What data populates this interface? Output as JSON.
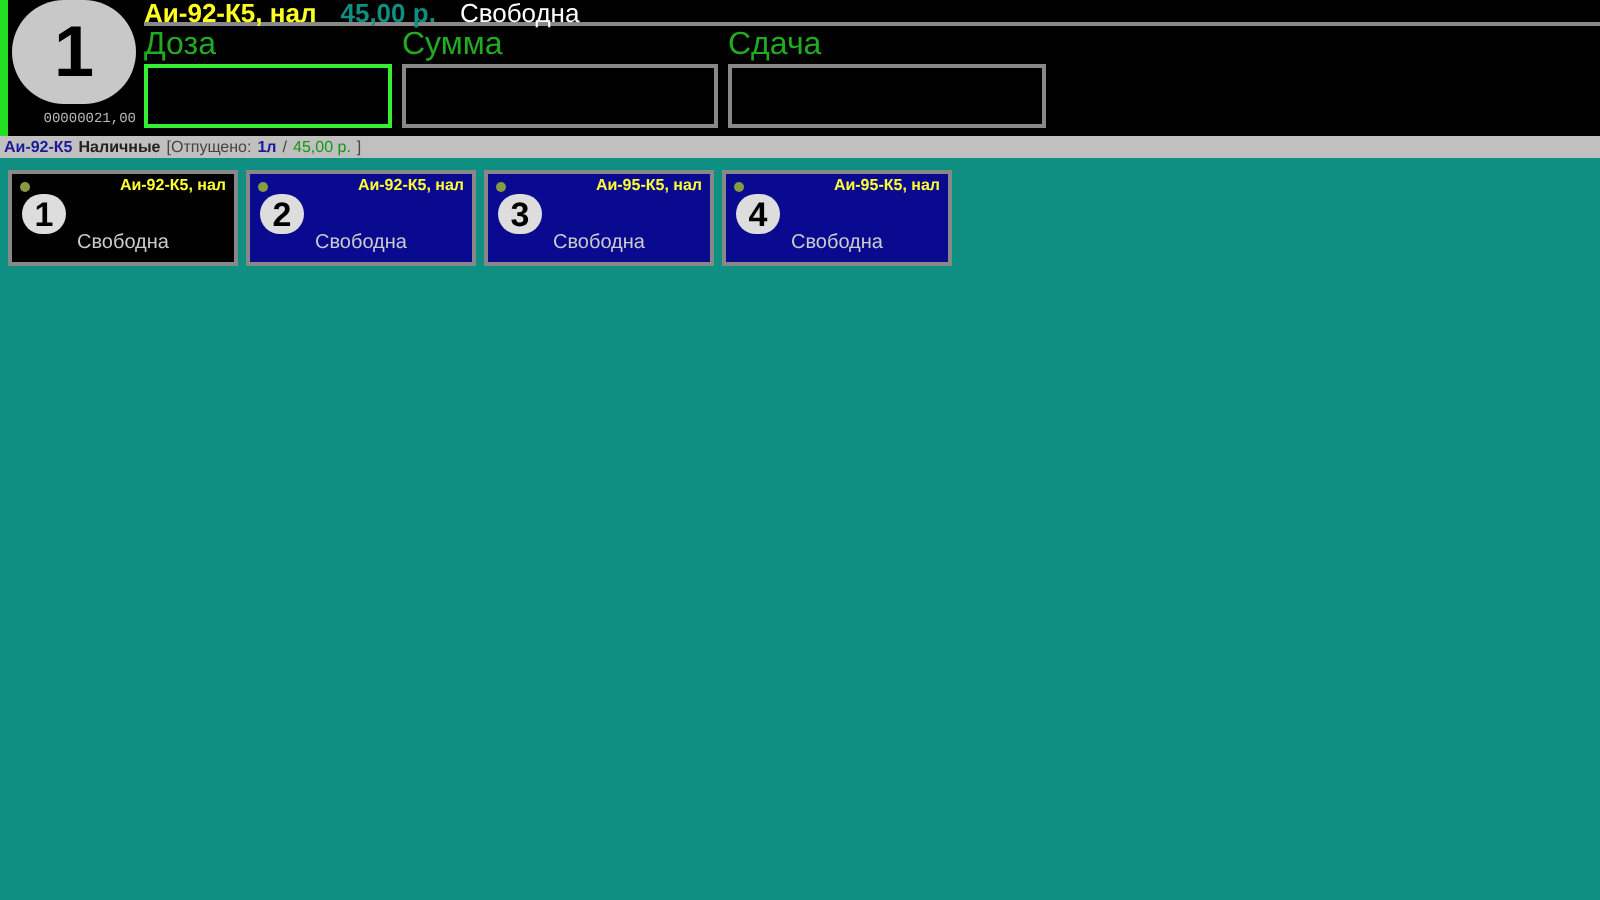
{
  "header": {
    "pump_number": "1",
    "fuel": "Аи-92-К5, нал",
    "price": "45,00 р.",
    "status": "Свободна",
    "counter": "00000021,00",
    "fields": [
      {
        "label": "Доза",
        "focused": true
      },
      {
        "label": "Сумма",
        "focused": false
      },
      {
        "label": "Сдача",
        "focused": false
      }
    ]
  },
  "status_bar": {
    "fuel": "Аи-92-К5",
    "payment": "Наличные",
    "dispensed_prefix": "[Отпущено:",
    "volume": "1л",
    "separator": "/",
    "amount": "45,00 р.",
    "close": "]"
  },
  "pumps": [
    {
      "number": "1",
      "fuel": "Аи-92-К5, нал",
      "status": "Свободна",
      "selected": true
    },
    {
      "number": "2",
      "fuel": "Аи-92-К5, нал",
      "status": "Свободна",
      "selected": false
    },
    {
      "number": "3",
      "fuel": "Аи-95-К5, нал",
      "status": "Свободна",
      "selected": false
    },
    {
      "number": "4",
      "fuel": "Аи-95-К5, нал",
      "status": "Свободна",
      "selected": false
    }
  ]
}
